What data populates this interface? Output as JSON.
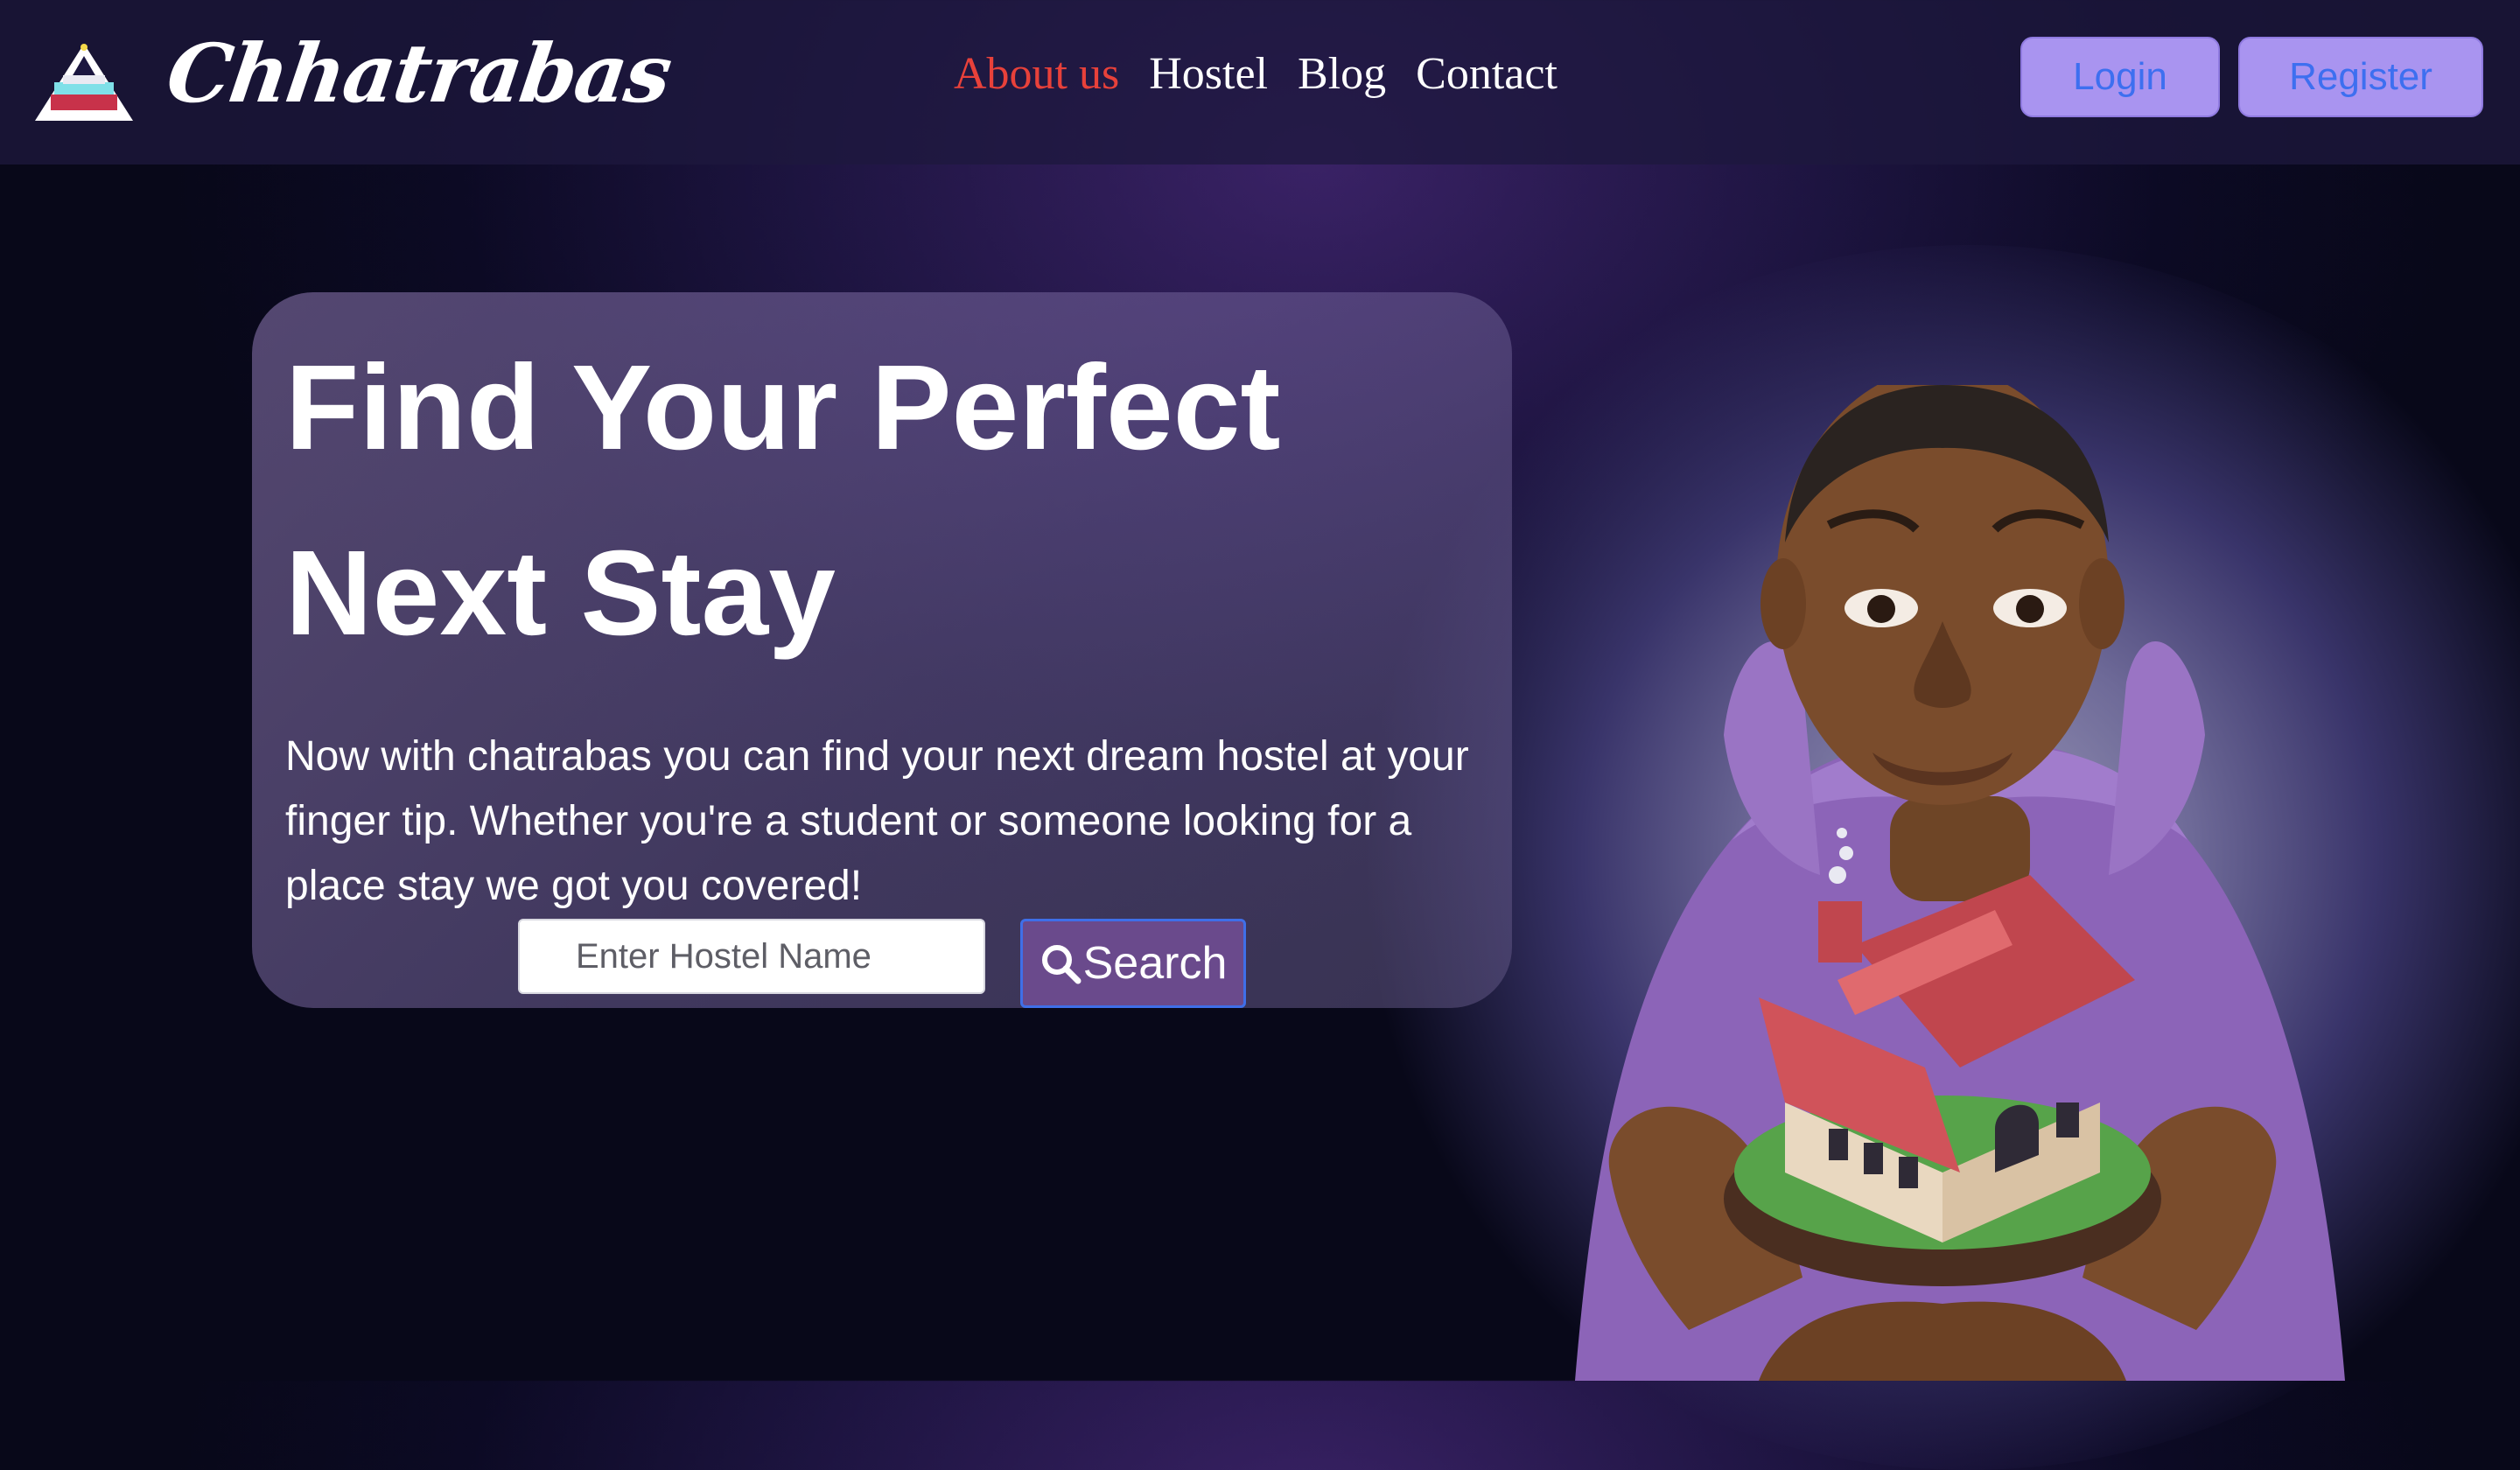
{
  "brand": {
    "name": "Chhatrabas",
    "logo_icon": "tent-bed-icon"
  },
  "nav": {
    "links": [
      {
        "label": "About us",
        "active": true
      },
      {
        "label": "Hostel",
        "active": false
      },
      {
        "label": "Blog",
        "active": false
      },
      {
        "label": "Contact",
        "active": false
      }
    ],
    "active_color": "#e8413a"
  },
  "auth": {
    "login_label": "Login",
    "register_label": "Register",
    "button_color": "#a994f0",
    "text_color": "#3d6ff0"
  },
  "hero": {
    "title_line1": "Find Your Perfect",
    "title_line2": "Next Stay",
    "description": "Now with chatrabas you can find your next dream hostel at your finger tip. Whether you're a student or someone looking for a place stay we got you covered!",
    "search": {
      "placeholder": "Enter Hostel Name",
      "value": "",
      "button_label": "Search",
      "button_icon": "search-icon"
    },
    "illustration": "person-holding-house-illustration"
  }
}
